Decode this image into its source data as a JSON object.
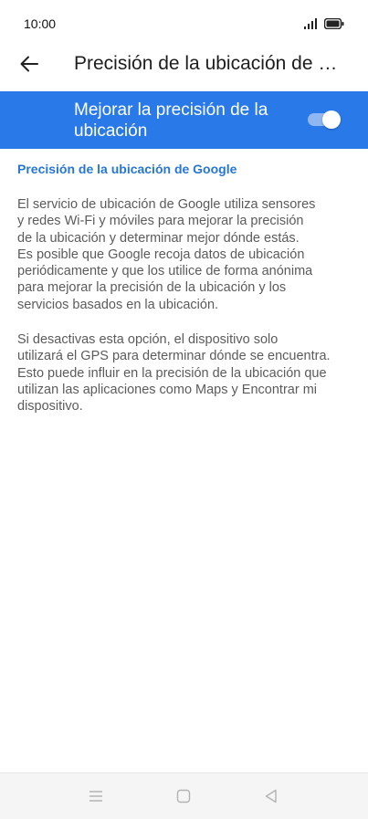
{
  "status_bar": {
    "time": "10:00"
  },
  "header": {
    "title": "Precisión de la ubicación de Google"
  },
  "toggle": {
    "label": "Mejorar la precisión de la ubicación",
    "checked": true,
    "accent_color": "#2979e9"
  },
  "content": {
    "section_title": "Precisión de la ubicación de Google",
    "paragraph_1": "El servicio de ubicación de Google utiliza sensores\ny redes Wi-Fi y móviles para mejorar la precisión\nde la ubicación y determinar mejor dónde estás.\nEs posible que Google recoja datos de ubicación\nperiódicamente y que los utilice de forma anónima\npara mejorar la precisión de la ubicación y los\nservicios basados en la ubicación.",
    "paragraph_2": "Si desactivas esta opción, el dispositivo solo\nutilizará el GPS para determinar dónde se encuentra.\nEsto puede influir en la precisión de la ubicación que\nutilizan las aplicaciones como Maps y Encontrar mi\ndispositivo."
  },
  "navigation": {
    "icons": [
      "menu-icon",
      "home-icon",
      "back-icon"
    ]
  }
}
